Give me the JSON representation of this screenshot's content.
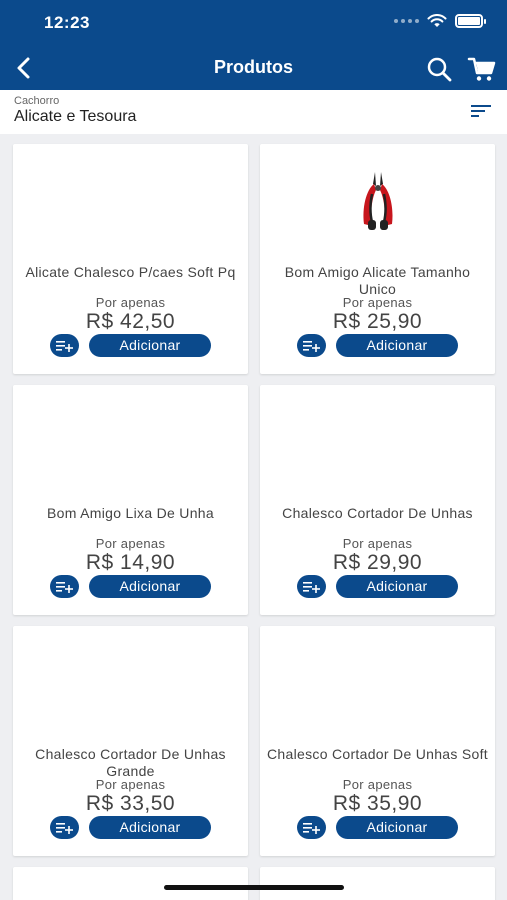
{
  "status_bar": {
    "time": "12:23"
  },
  "nav": {
    "title": "Produtos"
  },
  "breadcrumb": {
    "category": "Cachorro",
    "subcategory": "Alicate e Tesoura"
  },
  "colors": {
    "brand": "#0b4a8c",
    "background": "#eeeff2"
  },
  "products": [
    {
      "name": "Alicate Chalesco P/caes Soft Pq",
      "price_prefix": "Por apenas",
      "price": "R$ 42,50",
      "add_label": "Adicionar",
      "has_image": false
    },
    {
      "name": "Bom Amigo Alicate Tamanho Unico",
      "price_prefix": "Por apenas",
      "price": "R$ 25,90",
      "add_label": "Adicionar",
      "has_image": true
    },
    {
      "name": "Bom Amigo Lixa De Unha",
      "price_prefix": "Por apenas",
      "price": "R$ 14,90",
      "add_label": "Adicionar",
      "has_image": false
    },
    {
      "name": "Chalesco Cortador De Unhas",
      "price_prefix": "Por apenas",
      "price": "R$ 29,90",
      "add_label": "Adicionar",
      "has_image": false
    },
    {
      "name": "Chalesco Cortador De Unhas Grande",
      "price_prefix": "Por apenas",
      "price": "R$ 33,50",
      "add_label": "Adicionar",
      "has_image": false
    },
    {
      "name": "Chalesco Cortador De Unhas Soft",
      "price_prefix": "Por apenas",
      "price": "R$ 35,90",
      "add_label": "Adicionar",
      "has_image": false
    }
  ]
}
